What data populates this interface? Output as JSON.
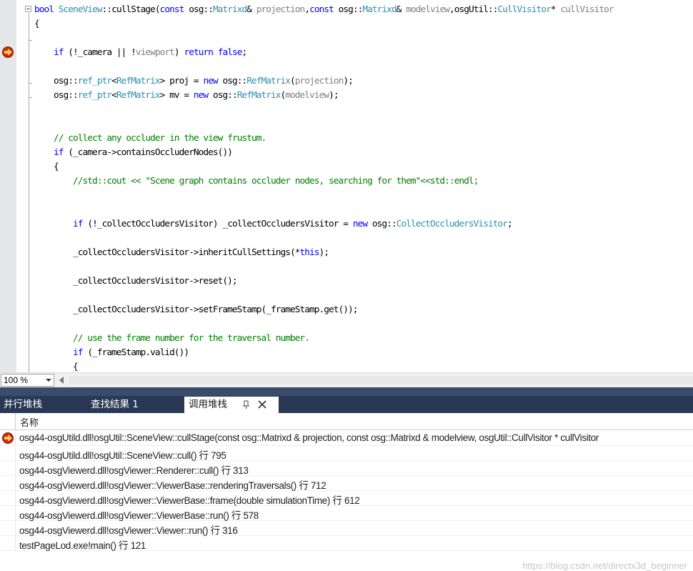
{
  "editor": {
    "lines": [
      [
        {
          "t": "bool",
          "c": "kw"
        },
        {
          "t": " "
        },
        {
          "t": "SceneView",
          "c": "ty"
        },
        {
          "t": "::cullStage("
        },
        {
          "t": "const",
          "c": "kw"
        },
        {
          "t": " osg::"
        },
        {
          "t": "Matrixd",
          "c": "ty"
        },
        {
          "t": "& "
        },
        {
          "t": "projection",
          "c": "pm"
        },
        {
          "t": ","
        },
        {
          "t": "const",
          "c": "kw"
        },
        {
          "t": " osg::"
        },
        {
          "t": "Matrixd",
          "c": "ty"
        },
        {
          "t": "& "
        },
        {
          "t": "modelview",
          "c": "pm"
        },
        {
          "t": ",osgUtil::"
        },
        {
          "t": "CullVisitor",
          "c": "ty"
        },
        {
          "t": "* "
        },
        {
          "t": "cullVisitor",
          "c": "pm"
        }
      ],
      [
        {
          "t": "{"
        }
      ],
      [],
      [
        {
          "t": "    "
        },
        {
          "t": "if",
          "c": "kw"
        },
        {
          "t": " (!_camera || !"
        },
        {
          "t": "viewport",
          "c": "pm"
        },
        {
          "t": ") "
        },
        {
          "t": "return",
          "c": "kw"
        },
        {
          "t": " "
        },
        {
          "t": "false",
          "c": "kw"
        },
        {
          "t": ";"
        }
      ],
      [],
      [
        {
          "t": "    osg::"
        },
        {
          "t": "ref_ptr",
          "c": "ty"
        },
        {
          "t": "<"
        },
        {
          "t": "RefMatrix",
          "c": "ty"
        },
        {
          "t": "> proj = "
        },
        {
          "t": "new",
          "c": "kw"
        },
        {
          "t": " osg::"
        },
        {
          "t": "RefMatrix",
          "c": "ty"
        },
        {
          "t": "("
        },
        {
          "t": "projection",
          "c": "pm"
        },
        {
          "t": ");"
        }
      ],
      [
        {
          "t": "    osg::"
        },
        {
          "t": "ref_ptr",
          "c": "ty"
        },
        {
          "t": "<"
        },
        {
          "t": "RefMatrix",
          "c": "ty"
        },
        {
          "t": "> mv = "
        },
        {
          "t": "new",
          "c": "kw"
        },
        {
          "t": " osg::"
        },
        {
          "t": "RefMatrix",
          "c": "ty"
        },
        {
          "t": "("
        },
        {
          "t": "modelview",
          "c": "pm"
        },
        {
          "t": ");"
        }
      ],
      [],
      [],
      [
        {
          "t": "    "
        },
        {
          "t": "// collect any occluder in the view frustum.",
          "c": "cm"
        }
      ],
      [
        {
          "t": "    "
        },
        {
          "t": "if",
          "c": "kw"
        },
        {
          "t": " (_camera->containsOccluderNodes())"
        }
      ],
      [
        {
          "t": "    {"
        }
      ],
      [
        {
          "t": "        "
        },
        {
          "t": "//std::cout << \"Scene graph contains occluder nodes, searching for them\"<<std::endl;",
          "c": "cm"
        }
      ],
      [],
      [],
      [
        {
          "t": "        "
        },
        {
          "t": "if",
          "c": "kw"
        },
        {
          "t": " (!_collectOccludersVisitor) _collectOccludersVisitor = "
        },
        {
          "t": "new",
          "c": "kw"
        },
        {
          "t": " osg::"
        },
        {
          "t": "CollectOccludersVisitor",
          "c": "ty"
        },
        {
          "t": ";"
        }
      ],
      [],
      [
        {
          "t": "        _collectOccludersVisitor->inheritCullSettings(*"
        },
        {
          "t": "this",
          "c": "kw"
        },
        {
          "t": ");"
        }
      ],
      [],
      [
        {
          "t": "        _collectOccludersVisitor->reset();"
        }
      ],
      [],
      [
        {
          "t": "        _collectOccludersVisitor->setFrameStamp(_frameStamp.get());"
        }
      ],
      [],
      [
        {
          "t": "        "
        },
        {
          "t": "// use the frame number for the traversal number.",
          "c": "cm"
        }
      ],
      [
        {
          "t": "        "
        },
        {
          "t": "if",
          "c": "kw"
        },
        {
          "t": " (_frameStamp.valid())"
        }
      ],
      [
        {
          "t": "        {"
        }
      ]
    ],
    "breakpoint_icon": "current-statement-arrow-icon",
    "collapse_icon": "collapse-minus-icon"
  },
  "zoom": {
    "value": "100 %"
  },
  "toolwindow": {
    "tabs": [
      {
        "label": "并行堆栈",
        "active": false
      },
      {
        "label": "查找结果 1",
        "active": false
      },
      {
        "label": "调用堆栈",
        "active": true
      }
    ],
    "pin_icon": "pin-icon",
    "close_icon": "close-icon",
    "column_header": "名称",
    "frames": [
      {
        "text": "osg44-osgUtild.dll!osgUtil::SceneView::cullStage(const osg::Matrixd & projection, const osg::Matrixd & modelview, osgUtil::CullVisitor * cullVisitor",
        "current": true
      },
      {
        "text": "osg44-osgUtild.dll!osgUtil::SceneView::cull() 行 795",
        "current": false
      },
      {
        "text": "osg44-osgViewerd.dll!osgViewer::Renderer::cull() 行 313",
        "current": false
      },
      {
        "text": "osg44-osgViewerd.dll!osgViewer::ViewerBase::renderingTraversals() 行 712",
        "current": false
      },
      {
        "text": "osg44-osgViewerd.dll!osgViewer::ViewerBase::frame(double simulationTime) 行 612",
        "current": false
      },
      {
        "text": "osg44-osgViewerd.dll!osgViewer::ViewerBase::run() 行 578",
        "current": false
      },
      {
        "text": "osg44-osgViewerd.dll!osgViewer::Viewer::run() 行 316",
        "current": false
      },
      {
        "text": "testPageLod.exe!main() 行 121",
        "current": false
      }
    ],
    "watermark": "https://blog.csdn.net/directx3d_beginner"
  },
  "colors": {
    "keyword": "#0000ff",
    "type": "#2b91af",
    "parameter": "#808080",
    "comment": "#008000",
    "tabstrip": "#293955"
  }
}
